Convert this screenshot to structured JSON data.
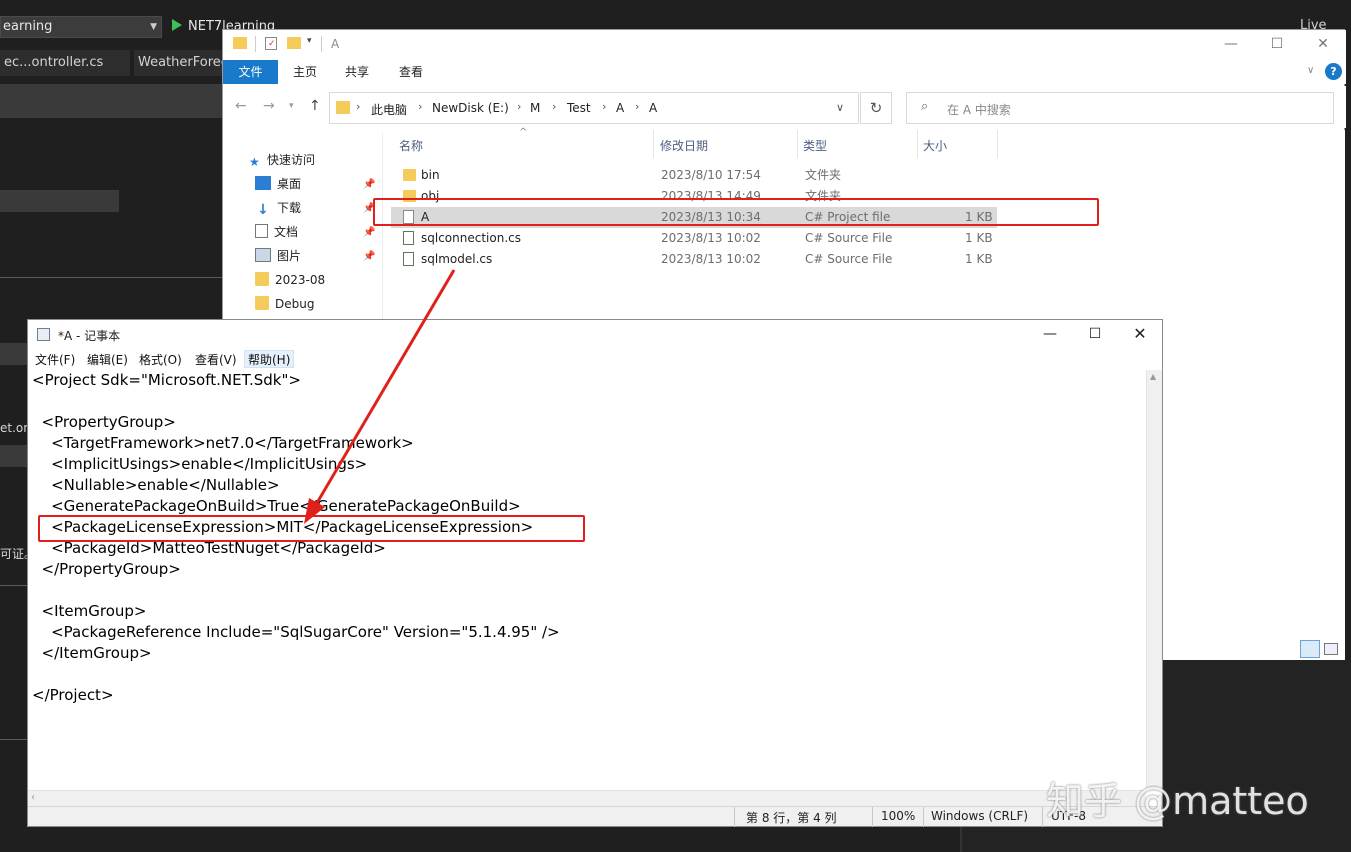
{
  "vs": {
    "project_combo": "earning",
    "run_label": "NET7learning",
    "live": "Live",
    "tabs": [
      "ec...ontroller.cs",
      "WeatherForec"
    ],
    "side_text_1": "et.or",
    "side_text_2": "可证。"
  },
  "explorer": {
    "title": "A",
    "ribbon_tabs": [
      "文件",
      "主页",
      "共享",
      "查看"
    ],
    "breadcrumb": [
      "此电脑",
      "NewDisk (E:)",
      "M",
      "Test",
      "A",
      "A"
    ],
    "search_placeholder": "在 A 中搜索",
    "sidebar": [
      {
        "label": "快速访问",
        "icon": "star-icon",
        "pinned": false
      },
      {
        "label": "桌面",
        "icon": "desktop-icon",
        "pinned": true
      },
      {
        "label": "下载",
        "icon": "download-icon",
        "pinned": true
      },
      {
        "label": "文档",
        "icon": "document-icon",
        "pinned": true
      },
      {
        "label": "图片",
        "icon": "picture-icon",
        "pinned": true
      },
      {
        "label": "2023-08",
        "icon": "folder-icon",
        "pinned": false
      },
      {
        "label": "Debug",
        "icon": "folder-icon",
        "pinned": false
      }
    ],
    "columns": [
      "名称",
      "修改日期",
      "类型",
      "大小"
    ],
    "files": [
      {
        "name": "bin",
        "date": "2023/8/10 17:54",
        "type": "文件夹",
        "size": "",
        "icon": "folder-icon"
      },
      {
        "name": "obj",
        "date": "2023/8/13 14:49",
        "type": "文件夹",
        "size": "",
        "icon": "folder-icon"
      },
      {
        "name": "A",
        "date": "2023/8/13 10:34",
        "type": "C# Project file",
        "size": "1 KB",
        "icon": "file-icon"
      },
      {
        "name": "sqlconnection.cs",
        "date": "2023/8/13 10:02",
        "type": "C# Source File",
        "size": "1 KB",
        "icon": "cs-file-icon"
      },
      {
        "name": "sqlmodel.cs",
        "date": "2023/8/13 10:02",
        "type": "C# Source File",
        "size": "1 KB",
        "icon": "cs-file-icon"
      }
    ]
  },
  "notepad": {
    "title": "*A - 记事本",
    "menu": [
      "文件(F)",
      "编辑(E)",
      "格式(O)",
      "查看(V)",
      "帮助(H)"
    ],
    "lines": [
      "<Project Sdk=\"Microsoft.NET.Sdk\">",
      "",
      "  <PropertyGroup>",
      "    <TargetFramework>net7.0</TargetFramework>",
      "    <ImplicitUsings>enable</ImplicitUsings>",
      "    <Nullable>enable</Nullable>",
      "    <GeneratePackageOnBuild>True</GeneratePackageOnBuild>",
      "    <PackageLicenseExpression>MIT</PackageLicenseExpression>",
      "    <PackageId>MatteoTestNuget</PackageId>",
      "  </PropertyGroup>",
      "",
      "  <ItemGroup>",
      "    <PackageReference Include=\"SqlSugarCore\" Version=\"5.1.4.95\" />",
      "  </ItemGroup>",
      "",
      "</Project>"
    ],
    "status": {
      "position": "第 8 行，第 4 列",
      "zoom": "100%",
      "line_ending": "Windows (CRLF)",
      "encoding": "UTF-8"
    }
  },
  "watermark": "知乎 @matteo",
  "colors": {
    "annotation_red": "#e0201a",
    "ribbon_blue": "#1979ca",
    "folder_yellow": "#f5cc5c"
  }
}
